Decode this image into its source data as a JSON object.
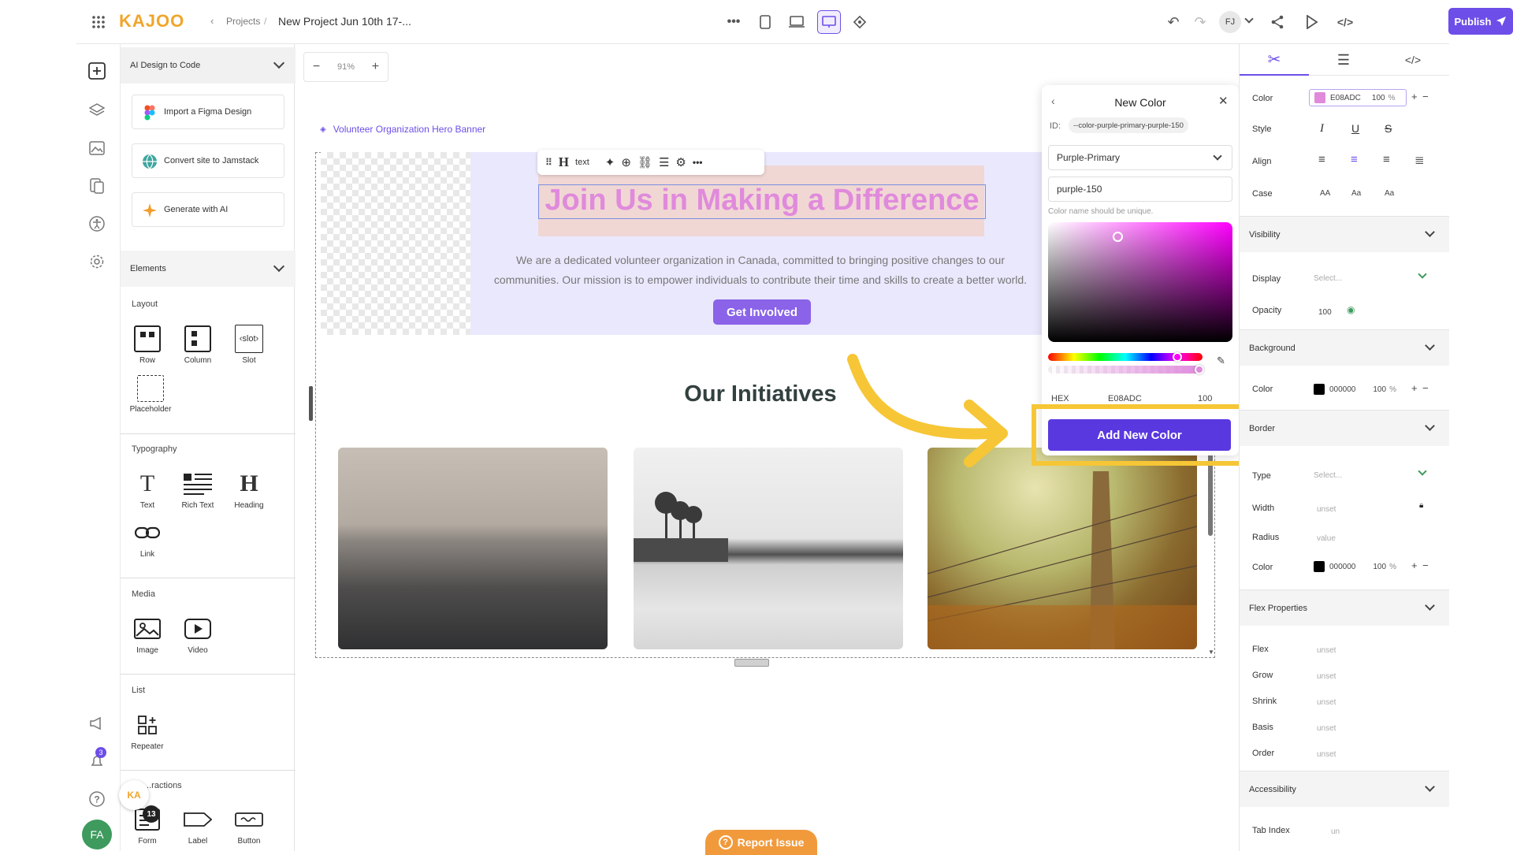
{
  "topbar": {
    "logo": "KAJOO",
    "breadcrumb_parent": "Projects",
    "breadcrumb_sep": "/",
    "project_title": "New Project Jun 10th 17-...",
    "user_initials": "FJ",
    "publish_label": "Publish"
  },
  "rail": {
    "notification_count": "3",
    "user_initials": "FA"
  },
  "left_panel": {
    "ai_section_title": "AI Design to Code",
    "import_figma": "Import a Figma Design",
    "convert_jamstack": "Convert site to Jamstack",
    "generate_ai": "Generate with AI",
    "elements_title": "Elements",
    "layout_label": "Layout",
    "layout_items": [
      "Row",
      "Column",
      "Slot",
      "Placeholder"
    ],
    "slot_glyph": "‹slot›",
    "typography_label": "Typography",
    "typography_items": [
      "Text",
      "Rich Text",
      "Heading",
      "Link"
    ],
    "media_label": "Media",
    "media_items": [
      "Image",
      "Video"
    ],
    "list_label": "List",
    "list_items": [
      "Repeater"
    ],
    "interactions_label": "...ractions",
    "interaction_items": [
      "Form",
      "Label",
      "Button"
    ],
    "helper_badge": "13"
  },
  "canvas": {
    "zoom": "91%",
    "component_label": "Volunteer Organization Hero Banner",
    "toolbar_text": "text",
    "hero_title": "Join Us in Making a Difference",
    "hero_desc_1": "We are a dedicated volunteer organization in Canada, committed to bringing positive changes to our",
    "hero_desc_2": "communities. Our mission is to empower individuals to contribute their time and skills to create a better world.",
    "cta": "Get Involved",
    "section_title": "Our Initiatives",
    "report_issue": "Report Issue"
  },
  "color_popup": {
    "title": "New Color",
    "id_label": "ID:",
    "id_value": "--color-purple-primary-purple-150",
    "palette": "Purple-Primary",
    "name_value": "purple-150",
    "hint": "Color name should be unique.",
    "mode": "HEX",
    "hex_value": "E08ADC",
    "opacity": "100",
    "percent": "%",
    "add_button": "Add New Color",
    "selected_color": "#E08ADC",
    "hue_color": "#ff00ff"
  },
  "right_panel": {
    "color_label": "Color",
    "color_hex": "E08ADC",
    "color_opacity": "100",
    "percent": "%",
    "style_label": "Style",
    "align_label": "Align",
    "case_label": "Case",
    "case_options": [
      "AA",
      "Aa",
      "Aa"
    ],
    "visibility_title": "Visibility",
    "display_label": "Display",
    "display_value": "Select...",
    "opacity_label": "Opacity",
    "opacity_value": "100",
    "background_title": "Background",
    "bg_color_label": "Color",
    "bg_color_hex": "000000",
    "bg_opacity": "100",
    "border_title": "Border",
    "border_type_label": "Type",
    "border_type_value": "Select...",
    "border_width_label": "Width",
    "border_width_value": "unset",
    "border_radius_label": "Radius",
    "border_radius_value": "value",
    "border_color_label": "Color",
    "border_color_hex": "000000",
    "border_opacity": "100",
    "flex_title": "Flex Properties",
    "flex_rows": [
      {
        "label": "Flex",
        "value": "unset"
      },
      {
        "label": "Grow",
        "value": "unset"
      },
      {
        "label": "Shrink",
        "value": "unset"
      },
      {
        "label": "Basis",
        "value": "unset"
      },
      {
        "label": "Order",
        "value": "unset"
      }
    ],
    "accessibility_title": "Accessibility",
    "tab_index_label": "Tab Index",
    "tab_index_value": "un"
  },
  "colors": {
    "accent": "#6d4ee8",
    "highlight": "#f6c636",
    "hero_title": "#E08ADC"
  }
}
